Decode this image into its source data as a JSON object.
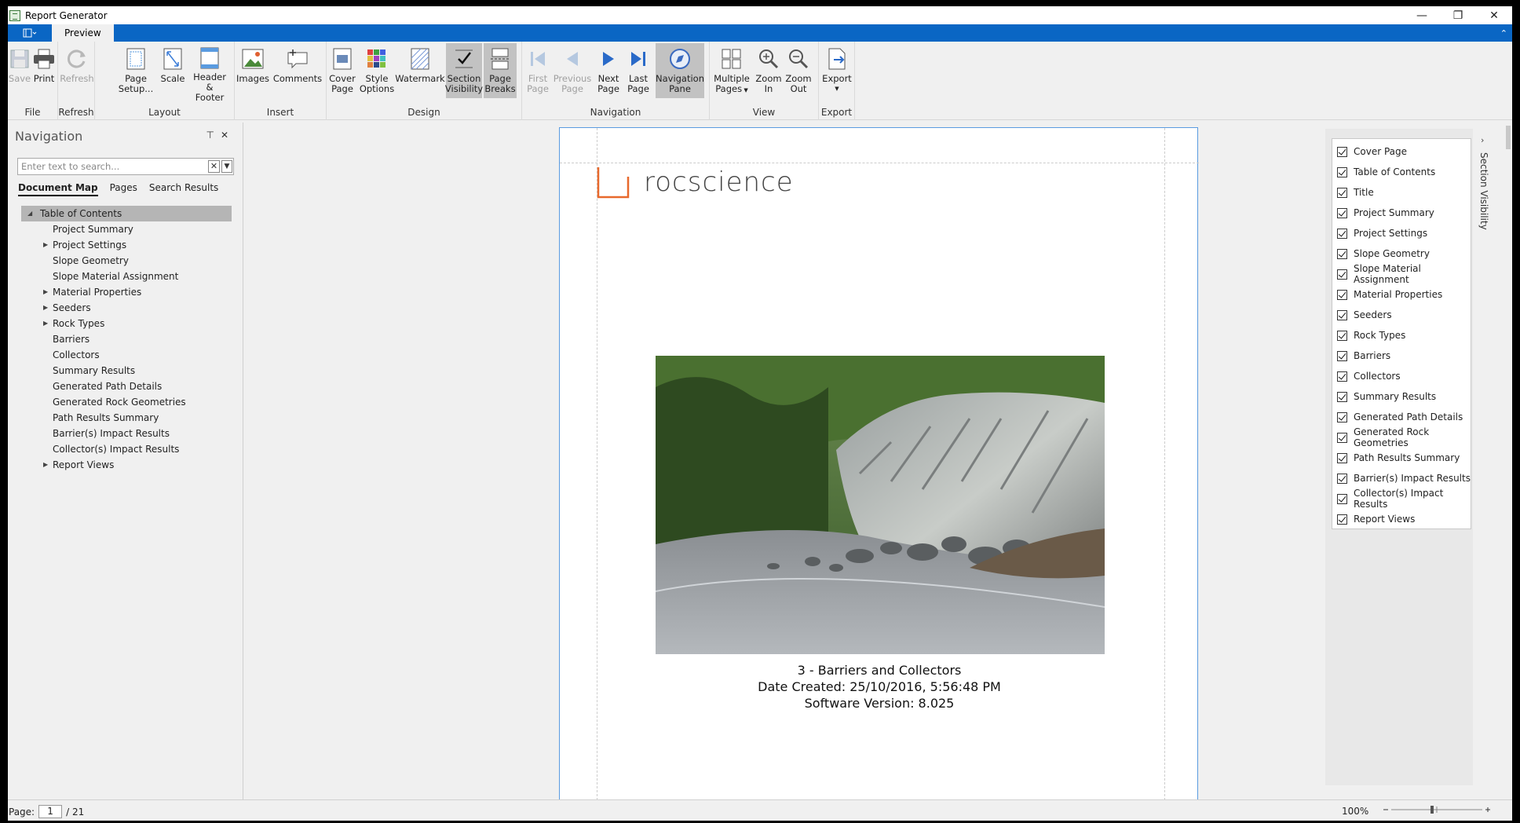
{
  "window": {
    "title": "Report Generator"
  },
  "ribbon_tabs": {
    "file_icon": "app-menu-icon",
    "preview": "Preview"
  },
  "ribbon": {
    "groups": {
      "file": "File",
      "refresh": "Refresh",
      "layout": "Layout",
      "insert": "Insert",
      "design": "Design",
      "navigation": "Navigation",
      "view": "View",
      "export": "Export"
    },
    "buttons": {
      "save": "Save",
      "print": "Print",
      "refresh": "Refresh",
      "page_setup_1": "Page",
      "page_setup_2": "Setup...",
      "scale": "Scale",
      "header_footer_1": "Header &",
      "header_footer_2": "Footer",
      "images": "Images",
      "comments": "Comments",
      "cover_page_1": "Cover",
      "cover_page_2": "Page",
      "style_options_1": "Style",
      "style_options_2": "Options",
      "watermark": "Watermark",
      "section_visibility_1": "Section",
      "section_visibility_2": "Visibility",
      "page_breaks_1": "Page",
      "page_breaks_2": "Breaks",
      "first_page_1": "First",
      "first_page_2": "Page",
      "previous_page_1": "Previous",
      "previous_page_2": "Page",
      "next_page_1": "Next",
      "next_page_2": "Page",
      "last_page_1": "Last",
      "last_page_2": "Page",
      "navigation_pane_1": "Navigation",
      "navigation_pane_2": "Pane",
      "multiple_pages_1": "Multiple",
      "multiple_pages_2": "Pages",
      "zoom_in_1": "Zoom",
      "zoom_in_2": "In",
      "zoom_out_1": "Zoom",
      "zoom_out_2": "Out",
      "export": "Export"
    }
  },
  "navigation": {
    "title": "Navigation",
    "search_placeholder": "Enter text to search...",
    "tabs": [
      "Document Map",
      "Pages",
      "Search Results"
    ],
    "tree_root": "Table of Contents",
    "tree": [
      {
        "label": "Project Summary",
        "expandable": false
      },
      {
        "label": "Project Settings",
        "expandable": true
      },
      {
        "label": "Slope Geometry",
        "expandable": false
      },
      {
        "label": "Slope Material Assignment",
        "expandable": false
      },
      {
        "label": "Material Properties",
        "expandable": true
      },
      {
        "label": "Seeders",
        "expandable": true
      },
      {
        "label": "Rock Types",
        "expandable": true
      },
      {
        "label": "Barriers",
        "expandable": false
      },
      {
        "label": "Collectors",
        "expandable": false
      },
      {
        "label": "Summary Results",
        "expandable": false
      },
      {
        "label": "Generated Path Details",
        "expandable": false
      },
      {
        "label": "Generated Rock Geometries",
        "expandable": false
      },
      {
        "label": "Path Results Summary",
        "expandable": false
      },
      {
        "label": "Barrier(s) Impact Results",
        "expandable": false
      },
      {
        "label": "Collector(s) Impact Results",
        "expandable": false
      },
      {
        "label": "Report Views",
        "expandable": true
      }
    ]
  },
  "document": {
    "logo_text": "rocscience",
    "caption_line1": "3 - Barriers and Collectors",
    "caption_line2": "Date Created: 25/10/2016, 5:56:48 PM",
    "caption_line3": "Software Version: 8.025"
  },
  "section_visibility": {
    "tab_label": "Section Visibility",
    "items": [
      "Cover Page",
      "Table of Contents",
      "Title",
      "Project Summary",
      "Project Settings",
      "Slope Geometry",
      "Slope Material Assignment",
      "Material Properties",
      "Seeders",
      "Rock Types",
      "Barriers",
      "Collectors",
      "Summary Results",
      "Generated Path Details",
      "Generated Rock Geometries",
      "Path Results Summary",
      "Barrier(s) Impact Results",
      "Collector(s) Impact Results",
      "Report Views"
    ]
  },
  "status": {
    "page_label": "Page:",
    "current_page": "1",
    "total": "/ 21",
    "zoom": "100%"
  },
  "colors": {
    "accent": "#0a66c4",
    "logo_orange": "#e8692c"
  }
}
